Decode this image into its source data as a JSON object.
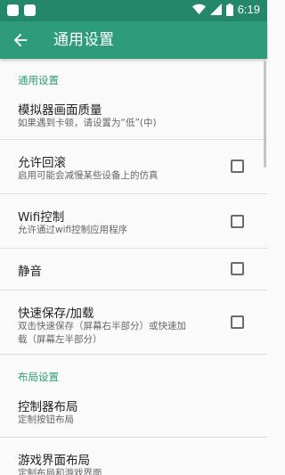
{
  "status_bar": {
    "time": "6:19"
  },
  "app_bar": {
    "title": "通用设置",
    "back_icon": "arrow-back-icon"
  },
  "sections": {
    "general": {
      "header": "通用设置"
    },
    "layout": {
      "header": "布局设置"
    }
  },
  "prefs": {
    "quality": {
      "title": "模拟器画面质量",
      "summary": "如果遇到卡顿，请设置为“低”(中)"
    },
    "rewind": {
      "title": "允许回滚",
      "summary": "启用可能会减慢某些设备上的仿真",
      "checked": false
    },
    "wifi": {
      "title": "Wifi控制",
      "summary": "允许通过wifi控制应用程序",
      "checked": false
    },
    "mute": {
      "title": "静音",
      "checked": false
    },
    "quicksave": {
      "title": "快速保存/加载",
      "summary_line1": "双击快速保存（屏幕右半部分）或快速加",
      "summary_line2": "载（屏幕左半部分）",
      "checked": false
    },
    "controller_layout": {
      "title": "控制器布局",
      "summary": "定制按钮布局"
    },
    "game_layout": {
      "title": "游戏界面布局",
      "summary": "定制布局和游戏界面"
    }
  },
  "colors": {
    "status_bar": "#25876a",
    "app_bar": "#2e9c79",
    "accent": "#2e9c79"
  }
}
